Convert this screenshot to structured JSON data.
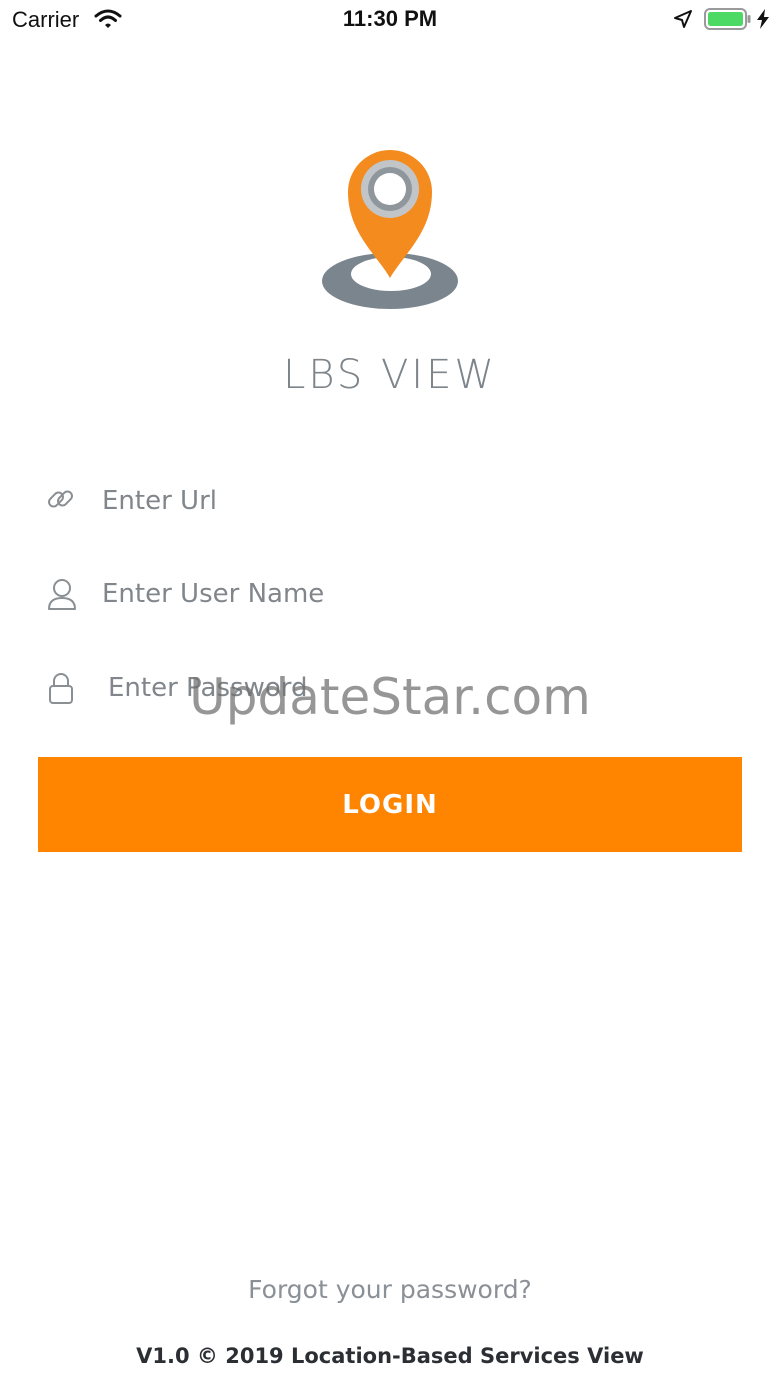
{
  "status_bar": {
    "carrier": "Carrier",
    "time": "11:30 PM",
    "icons": [
      "wifi-icon",
      "location-arrow-icon",
      "battery-icon",
      "charging-bolt-icon"
    ]
  },
  "app": {
    "name": "LBS VIEW",
    "logo_icon": "map-pin-icon"
  },
  "form": {
    "url_placeholder": "Enter Url",
    "url_value": "",
    "url_icon": "link-icon",
    "username_placeholder": "Enter User Name",
    "username_value": "",
    "username_icon": "user-icon",
    "password_placeholder": "Enter Password",
    "password_value": "",
    "password_icon": "lock-icon",
    "login_label": "LOGIN"
  },
  "watermark": "UpdateStar.com",
  "forgot_password": "Forgot your password?",
  "footer": "V1.0 © 2019 Location-Based Services View",
  "colors": {
    "accent": "#ff8400",
    "pin_gray": "#7b858d",
    "battery_green": "#4cd964"
  }
}
